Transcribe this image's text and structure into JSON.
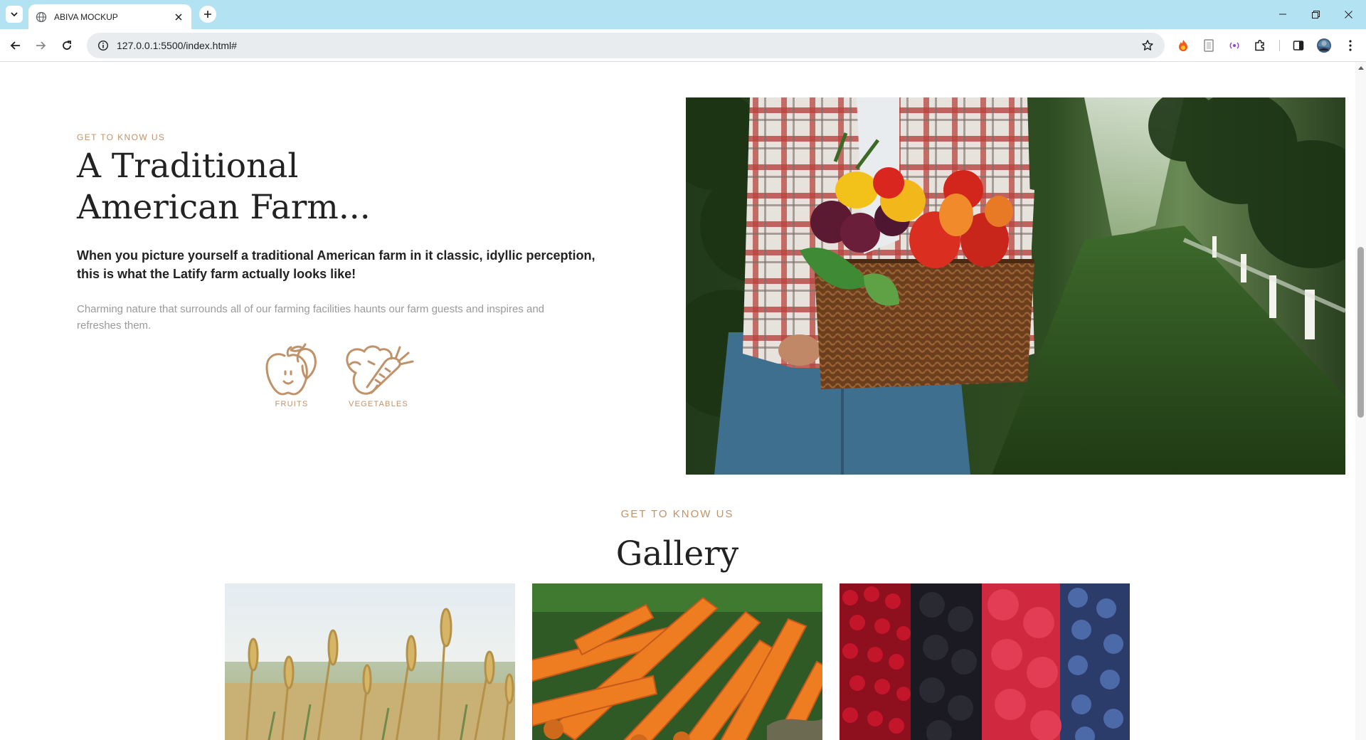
{
  "browser": {
    "tab_title": "ABIVA MOCKUP",
    "url": "127.0.0.1:5500/index.html#",
    "icons": [
      "tab-search-icon",
      "globe-icon",
      "close-icon",
      "plus-icon",
      "minimize-icon",
      "restore-icon",
      "close-window-icon",
      "back-icon",
      "forward-icon",
      "reload-icon",
      "site-info-icon",
      "bookmark-star-icon",
      "fire-extension-icon",
      "reader-extension-icon",
      "podcast-extension-icon",
      "extensions-puzzle-icon",
      "side-panel-icon",
      "profile-avatar-icon",
      "kebab-menu-icon"
    ]
  },
  "about": {
    "kicker": "GET TO KNOW US",
    "title": "A Traditional American Farm...",
    "lead": "When you picture yourself a traditional American farm in it classic, idyllic perception, this is what the Latify farm actually looks like!",
    "body": "Charming nature that surrounds all of our farming facilities haunts our farm guests and inspires and refreshes them.",
    "features": [
      {
        "label": "FRUITS",
        "icon": "apple-pear-icon"
      },
      {
        "label": "VEGETABLES",
        "icon": "vegetables-icon"
      }
    ],
    "photo": "farmer-holding-vegetable-basket"
  },
  "gallery": {
    "kicker": "GET TO KNOW US",
    "title": "Gallery",
    "images": [
      "wheat-field-photo",
      "carrots-photo",
      "berries-photo"
    ]
  },
  "colors": {
    "accent": "#c0926a",
    "tabbar": "#b3e3f2",
    "heading": "#222222",
    "muted": "#9a9a9a"
  }
}
